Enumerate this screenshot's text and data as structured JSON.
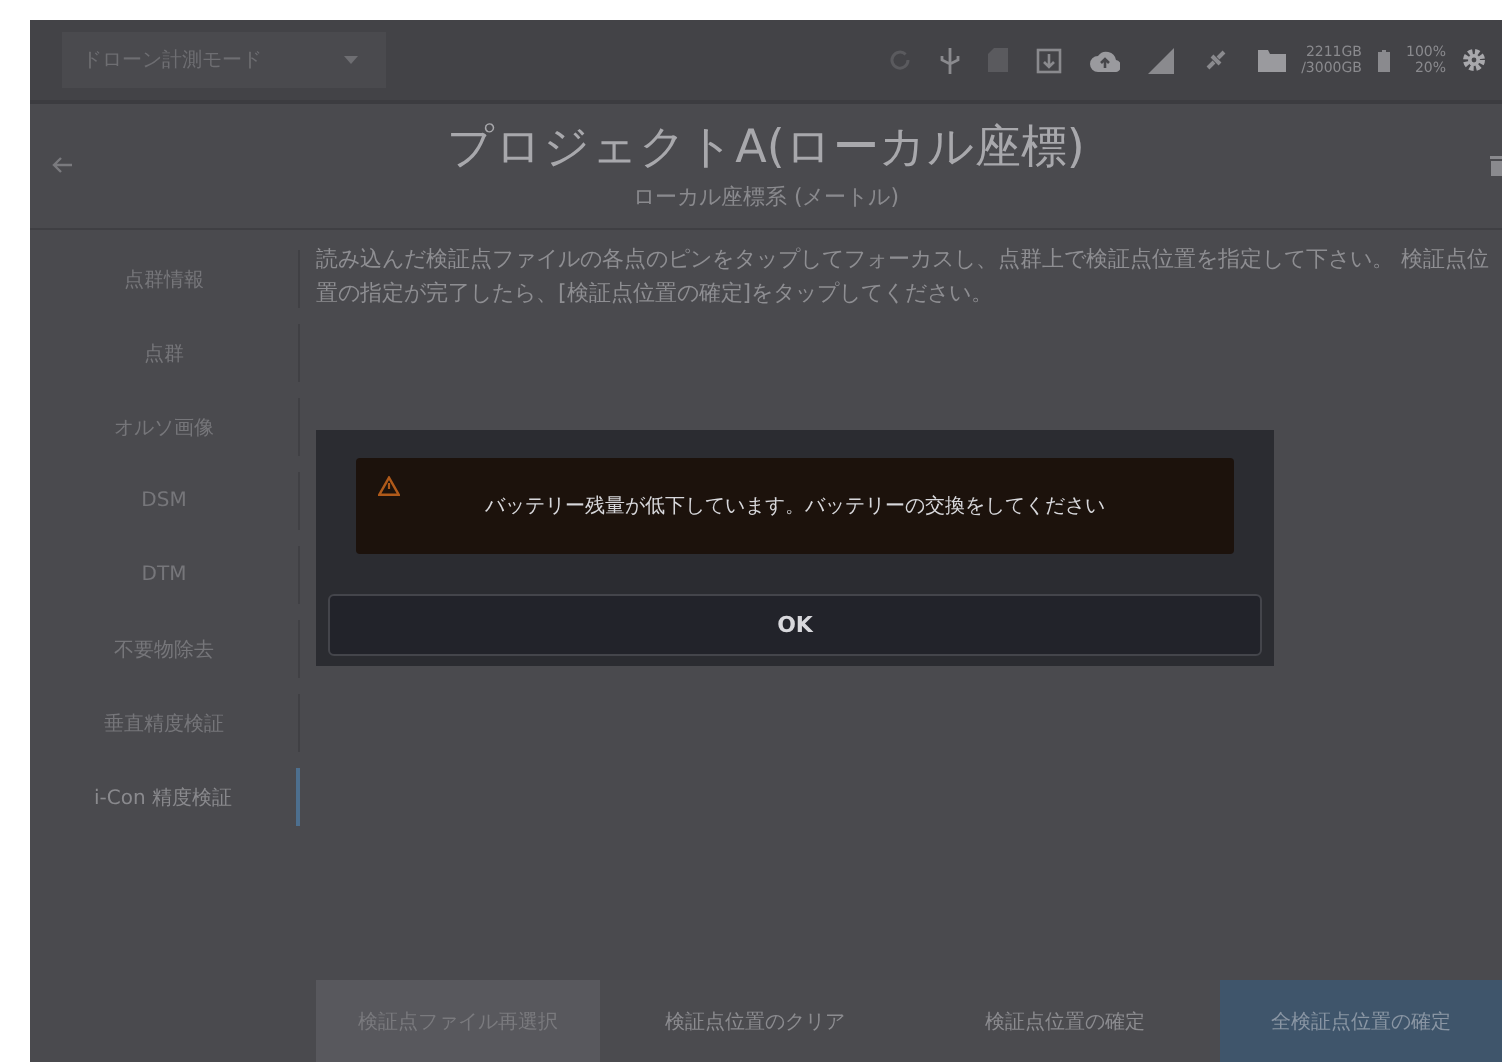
{
  "topbar": {
    "mode_dropdown": {
      "value": "ドローン計測モード"
    },
    "storage": [
      "2211GB",
      "/3000GB"
    ],
    "battery": [
      "100%",
      "20%"
    ]
  },
  "header": {
    "title": "プロジェクトA(ローカル座標)",
    "subtitle": "ローカル座標系 (メートル)"
  },
  "sidebar": {
    "items": [
      {
        "label": "点群情報",
        "selected": false
      },
      {
        "label": "点群",
        "selected": false
      },
      {
        "label": "オルソ画像",
        "selected": false
      },
      {
        "label": "DSM",
        "selected": false
      },
      {
        "label": "DTM",
        "selected": false
      },
      {
        "label": "不要物除去",
        "selected": false
      },
      {
        "label": "垂直精度検証",
        "selected": false
      },
      {
        "label": "i-Con 精度検証",
        "selected": true
      }
    ]
  },
  "instruction": "読み込んだ検証点ファイルの各点のピンをタップしてフォーカスし、点群上で検証点位置を指定して下さい。 検証点位置の指定が完了したら、[検証点位置の確定]をタップしてください。",
  "dialog": {
    "message": "バッテリー残量が低下しています。バッテリーの交換をしてください",
    "button": "OK"
  },
  "bottom_buttons": [
    {
      "label": "検証点ファイル再選択",
      "kind": "secondary"
    },
    {
      "label": "検証点位置のクリア",
      "kind": "disabled"
    },
    {
      "label": "検証点位置の確定",
      "kind": "disabled"
    },
    {
      "label": "全検証点位置の確定",
      "kind": "primary"
    }
  ]
}
